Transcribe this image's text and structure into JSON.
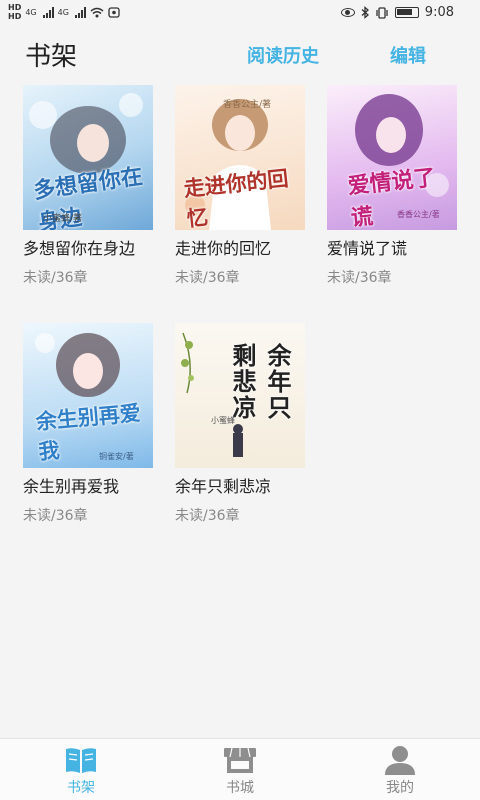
{
  "status_bar": {
    "hd1": "HD",
    "hd2": "HD",
    "net1": "4G",
    "net2": "4G",
    "time": "9:08"
  },
  "header": {
    "title": "书架",
    "history": "阅读历史",
    "edit": "编辑"
  },
  "books": [
    {
      "title": "多想留你在身边",
      "progress": "未读/36章",
      "cover_text": "多想留你在身边",
      "cover_author": "小蜜蜂/著",
      "cover_colors": [
        "#cfe6f6",
        "#7fb7e0"
      ]
    },
    {
      "title": "走进你的回忆",
      "progress": "未读/36章",
      "cover_text": "走进你的回忆",
      "cover_author": "香香公主/著",
      "cover_colors": [
        "#fbe8d8",
        "#f3c9a8"
      ]
    },
    {
      "title": "爱情说了谎",
      "progress": "未读/36章",
      "cover_text": "爱情说了谎",
      "cover_author": "香香公主/著",
      "cover_colors": [
        "#f6d8f0",
        "#d7a3e6"
      ]
    },
    {
      "title": "余生别再爱我",
      "progress": "未读/36章",
      "cover_text": "余生别再爱我",
      "cover_author": "铜雀安/著",
      "cover_colors": [
        "#d7ecfb",
        "#8ac3ee"
      ]
    },
    {
      "title": "余年只剩悲凉",
      "progress": "未读/36章",
      "cover_text": "余年只剩悲凉",
      "cover_author": "小蜜蜂",
      "cover_colors": [
        "#faf6ee",
        "#f1e8d6"
      ]
    }
  ],
  "bottom_nav": [
    {
      "label": "书架",
      "icon": "book-icon",
      "active": true
    },
    {
      "label": "书城",
      "icon": "store-icon",
      "active": false
    },
    {
      "label": "我的",
      "icon": "person-icon",
      "active": false
    }
  ],
  "colors": {
    "accent": "#45b4e3",
    "inactive": "#888888"
  }
}
